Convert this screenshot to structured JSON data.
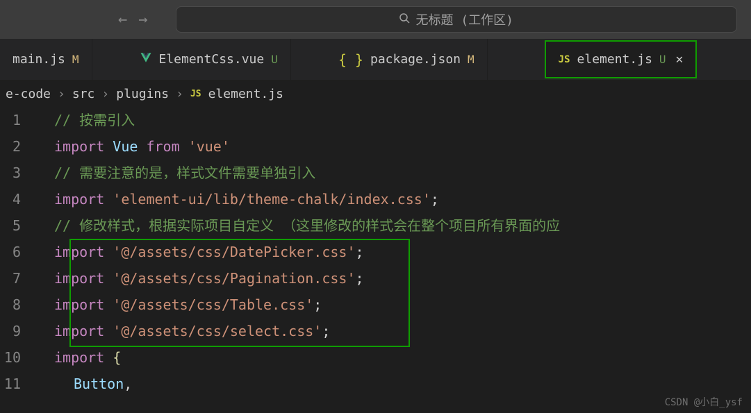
{
  "titleBar": {
    "searchText": "无标题 (工作区)"
  },
  "tabs": [
    {
      "icon": "js",
      "name": "main.js",
      "status": "M"
    },
    {
      "icon": "vue",
      "name": "ElementCss.vue",
      "status": "U"
    },
    {
      "icon": "json",
      "name": "package.json",
      "status": "M"
    },
    {
      "icon": "js",
      "name": "element.js",
      "status": "U",
      "active": true,
      "closeable": true
    }
  ],
  "breadcrumb": {
    "parts": [
      "e-code",
      "src",
      "plugins"
    ],
    "fileIcon": "js",
    "fileName": "element.js"
  },
  "code": {
    "lines": [
      {
        "n": "1",
        "tokens": [
          {
            "t": "comment",
            "v": "// 按需引入"
          }
        ]
      },
      {
        "n": "2",
        "tokens": [
          {
            "t": "keyword",
            "v": "import"
          },
          {
            "t": "plain",
            "v": " "
          },
          {
            "t": "var",
            "v": "Vue"
          },
          {
            "t": "plain",
            "v": " "
          },
          {
            "t": "keyword",
            "v": "from"
          },
          {
            "t": "plain",
            "v": " "
          },
          {
            "t": "string",
            "v": "'vue'"
          }
        ]
      },
      {
        "n": "3",
        "tokens": [
          {
            "t": "comment",
            "v": "// 需要注意的是，样式文件需要单独引入"
          }
        ]
      },
      {
        "n": "4",
        "tokens": [
          {
            "t": "keyword",
            "v": "import"
          },
          {
            "t": "plain",
            "v": " "
          },
          {
            "t": "string",
            "v": "'element-ui/lib/theme-chalk/index.css'"
          },
          {
            "t": "punct",
            "v": ";"
          }
        ]
      },
      {
        "n": "5",
        "tokens": [
          {
            "t": "comment",
            "v": "// 修改样式，根据实际项目自定义 （这里修改的样式会在整个项目所有界面的应"
          }
        ]
      },
      {
        "n": "6",
        "tokens": [
          {
            "t": "keyword",
            "v": "import"
          },
          {
            "t": "plain",
            "v": " "
          },
          {
            "t": "string",
            "v": "'@/assets/css/DatePicker.css'"
          },
          {
            "t": "punct",
            "v": ";"
          }
        ]
      },
      {
        "n": "7",
        "tokens": [
          {
            "t": "keyword",
            "v": "import"
          },
          {
            "t": "plain",
            "v": " "
          },
          {
            "t": "string",
            "v": "'@/assets/css/Pagination.css'"
          },
          {
            "t": "punct",
            "v": ";"
          }
        ]
      },
      {
        "n": "8",
        "tokens": [
          {
            "t": "keyword",
            "v": "import"
          },
          {
            "t": "plain",
            "v": " "
          },
          {
            "t": "string",
            "v": "'@/assets/css/Table.css'"
          },
          {
            "t": "punct",
            "v": ";"
          }
        ]
      },
      {
        "n": "9",
        "tokens": [
          {
            "t": "keyword",
            "v": "import"
          },
          {
            "t": "plain",
            "v": " "
          },
          {
            "t": "string",
            "v": "'@/assets/css/select.css'"
          },
          {
            "t": "punct",
            "v": ";"
          }
        ]
      },
      {
        "n": "10",
        "tokens": [
          {
            "t": "keyword",
            "v": "import"
          },
          {
            "t": "plain",
            "v": " "
          },
          {
            "t": "brace",
            "v": "{"
          }
        ]
      },
      {
        "n": "11",
        "indent": 2,
        "tokens": [
          {
            "t": "var",
            "v": "Button"
          },
          {
            "t": "punct",
            "v": ","
          }
        ]
      }
    ]
  },
  "watermark": "CSDN @小白_ysf"
}
